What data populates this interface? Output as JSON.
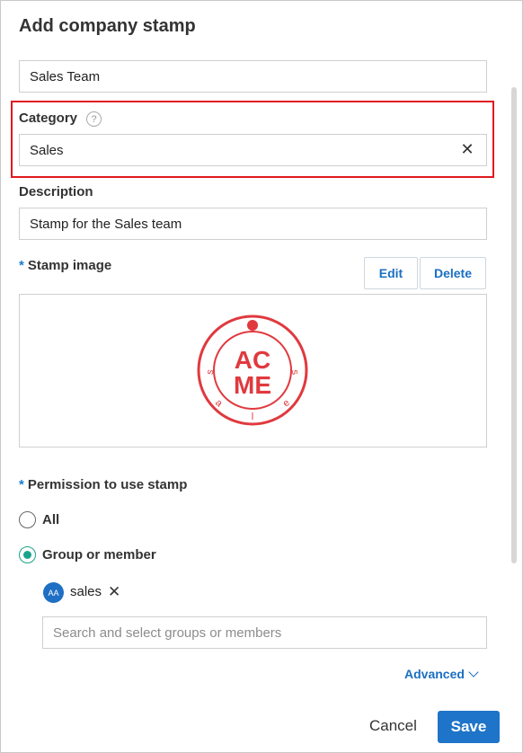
{
  "dialog": {
    "title": "Add company stamp"
  },
  "form": {
    "name_value": "Sales Team",
    "category": {
      "label": "Category",
      "help_symbol": "?",
      "value": "Sales",
      "clear_symbol": "✕"
    },
    "description": {
      "label": "Description",
      "value": "Stamp for the Sales team"
    },
    "stamp_image": {
      "required_mark": "*",
      "label": "Stamp image",
      "edit_label": "Edit",
      "delete_label": "Delete",
      "stamp": {
        "line1": "AC",
        "line2": "ME",
        "ring_letters": [
          "s",
          "a",
          "l",
          "e",
          "s"
        ],
        "color": "#e0393e"
      }
    },
    "permission": {
      "required_mark": "*",
      "label": "Permission to use stamp",
      "options": [
        {
          "label": "All",
          "checked": false
        },
        {
          "label": "Group or member",
          "checked": true
        }
      ],
      "selected_member": {
        "avatar_text": "AA",
        "name": "sales",
        "remove_symbol": "✕"
      },
      "search_placeholder": "Search and select groups or members"
    },
    "advanced_label": "Advanced"
  },
  "footer": {
    "cancel_label": "Cancel",
    "save_label": "Save"
  },
  "colors": {
    "accent": "#1e74c8",
    "radio_checked": "#19a38c",
    "highlight": "#e0191f"
  }
}
